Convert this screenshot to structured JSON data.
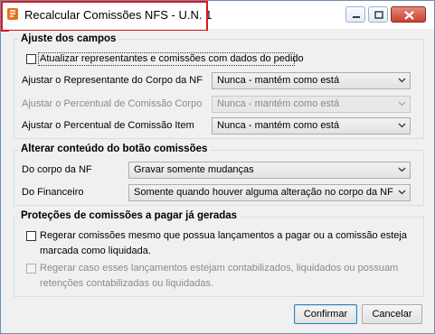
{
  "window": {
    "title": "Recalcular Comissões NFS - U.N. 1"
  },
  "ajuste": {
    "title": "Ajuste dos campos",
    "atualizar_label": "Atualizar representantes e comissões com dados do pedido",
    "rows": [
      {
        "label": "Ajustar o Representante do Corpo da NF",
        "value": "Nunca - mantém como está",
        "disabled": false
      },
      {
        "label": "Ajustar o Percentual de Comissão Corpo",
        "value": "Nunca - mantém como está",
        "disabled": true
      },
      {
        "label": "Ajustar o Percentual de Comissão Item",
        "value": "Nunca - mantém como está",
        "disabled": false
      }
    ]
  },
  "alterar": {
    "title": "Alterar conteúdo do botão comissões",
    "rows": [
      {
        "label": "Do corpo da NF",
        "value": "Gravar somente mudanças"
      },
      {
        "label": "Do Financeiro",
        "value": "Somente quando houver alguma alteração no corpo da NF"
      }
    ]
  },
  "protecoes": {
    "title": "Proteções de comissões a pagar já geradas",
    "regerar_line1": "Regerar comissões mesmo que possua lançamentos a pagar ou a comissão esteja",
    "regerar_line2": "marcada como liquidada.",
    "regerar_caso_line1": "Regerar caso esses lançamentos estejam contabilizados, liquidados ou possuam",
    "regerar_caso_line2": "retenções contabilizadas ou liquidadas."
  },
  "buttons": {
    "confirmar": "Confirmar",
    "cancelar": "Cancelar"
  },
  "colors": {
    "highlight": "#e0151b",
    "app_icon": "#e8731c",
    "close_button": "#c9402f"
  }
}
